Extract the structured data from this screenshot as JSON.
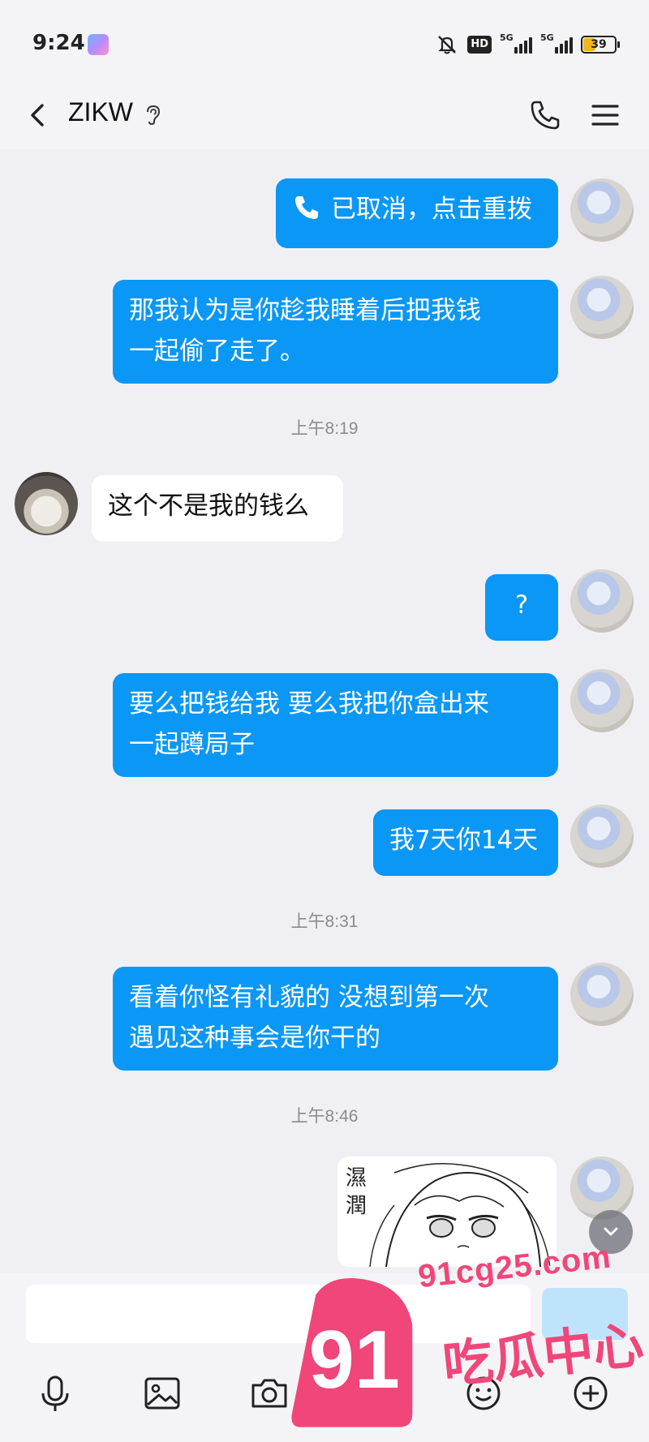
{
  "status_bar": {
    "time": "9:24",
    "battery": "39",
    "hd_label": "HD",
    "network_1": "5G",
    "network_2": "5G"
  },
  "nav": {
    "contact_name": "ZIKW"
  },
  "messages": [
    {
      "text": "已取消，点击重拨",
      "from": "me",
      "type": "call"
    },
    {
      "text_line1": "那我认为是你趁我睡着后把我钱",
      "text_line2": "一起偷了走了。",
      "from": "me"
    },
    {
      "time": "上午8:19"
    },
    {
      "text": "这个不是我的钱么",
      "from": "them"
    },
    {
      "text": "?",
      "from": "me"
    },
    {
      "text_line1": "要么把钱给我 要么我把你盒出来",
      "text_line2": "一起蹲局子",
      "from": "me"
    },
    {
      "text": "我7天你14天",
      "from": "me"
    },
    {
      "time": "上午8:31"
    },
    {
      "text_line1": "看着你怪有礼貌的 没想到第一次",
      "text_line2": "遇见这种事会是你干的",
      "from": "me"
    },
    {
      "time": "上午8:46"
    },
    {
      "sticker_text_1": "濕",
      "sticker_text_2": "潤",
      "from": "me",
      "type": "sticker"
    }
  ],
  "input": {
    "placeholder": "",
    "value": ""
  },
  "watermark": {
    "number": "91",
    "url": "91cg25.com",
    "label": "吃瓜中心"
  },
  "colors": {
    "outgoing_bubble": "#0a97f5",
    "incoming_bubble": "#ffffff",
    "background": "#f0f0f4",
    "watermark": "#f0467a"
  },
  "icons": [
    "voice-icon",
    "image-icon",
    "camera-icon",
    "red-packet-icon",
    "emoji-icon",
    "plus-icon"
  ]
}
